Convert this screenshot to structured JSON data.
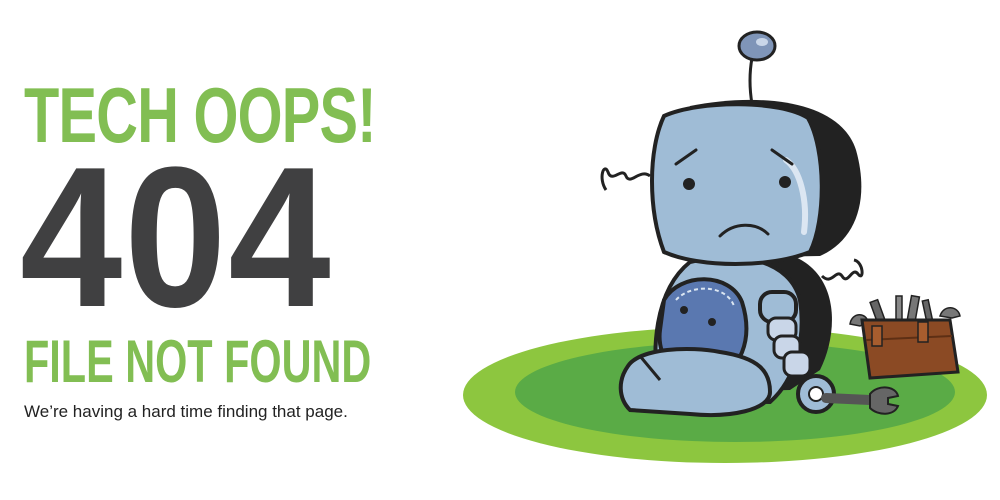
{
  "error": {
    "headline": "TECH OOPS!",
    "code": "404",
    "subheadline": "FILE NOT FOUND",
    "message": "We’re having a hard time finding that page."
  },
  "colors": {
    "accent_green": "#82be53",
    "dark_gray": "#404041",
    "robot_blue": "#9fbcd6",
    "grass_light": "#8dc63f",
    "grass_dark": "#5aab46",
    "toolbox_brown": "#8b4a24"
  },
  "illustration": {
    "subject": "sad-robot",
    "props": [
      "toolbox",
      "wrench"
    ]
  }
}
